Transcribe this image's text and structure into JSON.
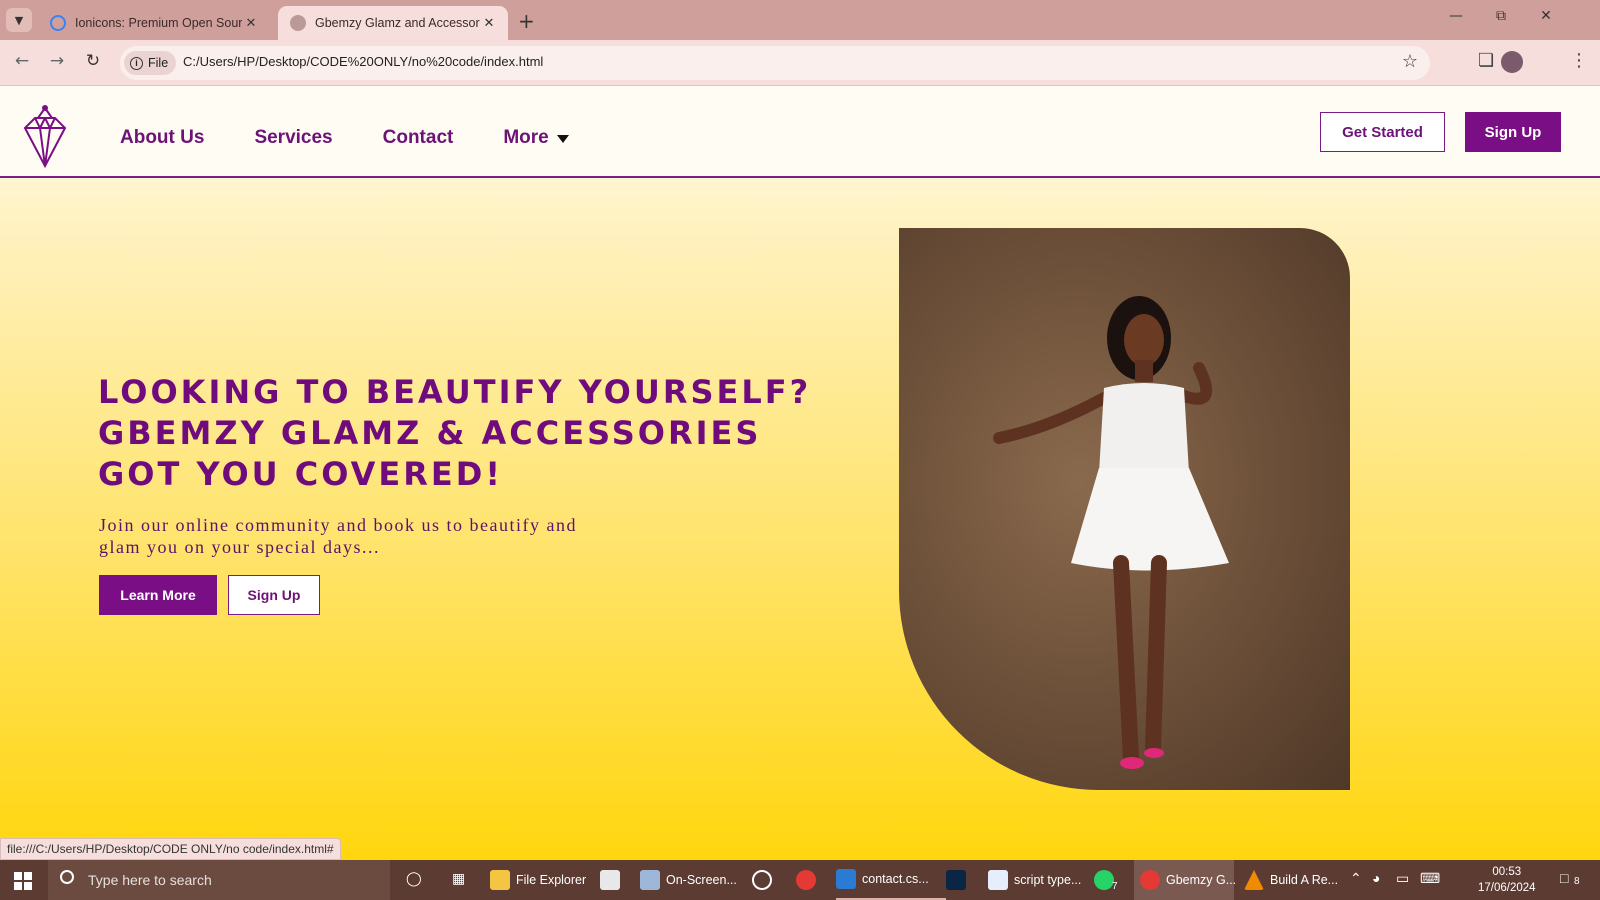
{
  "browser": {
    "tabs": [
      {
        "title": "Ionicons: Premium Open Source",
        "active": false
      },
      {
        "title": "Gbemzy Glamz and Accessories",
        "active": true
      }
    ],
    "address_chip": "File",
    "url": "C:/Users/HP/Desktop/CODE%20ONLY/no%20code/index.html",
    "status_link": "file:///C:/Users/HP/Desktop/CODE ONLY/no code/index.html#"
  },
  "site": {
    "nav": {
      "links": [
        "About Us",
        "Services",
        "Contact",
        "More"
      ],
      "get_started": "Get Started",
      "sign_up": "Sign Up"
    },
    "hero": {
      "title_lines": [
        "Looking to beautify yourself?",
        "Gbemzy Glamz & Accessories",
        "got you covered!"
      ],
      "subtitle": "Join our online community and book us to beautify and glam you on your special days...",
      "learn_more": "Learn More",
      "sign_up": "Sign Up"
    },
    "colors": {
      "brand_purple": "#7a0f85",
      "page_gradient_bottom": "#ffd60d",
      "page_gradient_top": "#fffbea"
    }
  },
  "taskbar": {
    "search_placeholder": "Type here to search",
    "apps": [
      {
        "label": "File Explorer"
      },
      {
        "label": "On-Screen..."
      },
      {
        "label": "contact.cs..."
      },
      {
        "label": "script type..."
      },
      {
        "label": "Gbemzy G..."
      },
      {
        "label": "Build A Re..."
      }
    ],
    "whatsapp_badge": "7",
    "notification_count": "8",
    "time": "00:53",
    "date": "17/06/2024"
  }
}
